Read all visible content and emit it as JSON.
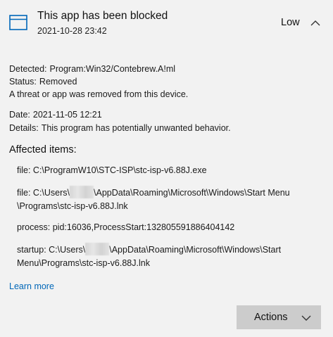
{
  "header": {
    "title": "This app has been blocked",
    "timestamp": "2021-10-28 23:42",
    "severity": "Low",
    "app_icon": "app-window-icon",
    "chevron_icon": "chevron-up-icon"
  },
  "details": {
    "detected_label": "Detected:",
    "detected_value": "Program:Win32/Contebrew.A!ml",
    "status_label": "Status:",
    "status_value": "Removed",
    "status_message": "A threat or app was removed from this device.",
    "date_label": "Date:",
    "date_value": "2021-11-05 12:21",
    "details_label": "Details:",
    "details_value": "This program has potentially unwanted behavior."
  },
  "affected": {
    "heading": "Affected items:",
    "items": [
      {
        "line1": "file: C:\\ProgramW10\\STC-ISP\\stc-isp-v6.88J.exe"
      },
      {
        "line1_pre": "file: C:\\Users\\",
        "line1_post": "\\AppData\\Roaming\\Microsoft\\Windows\\Start Menu",
        "line2": "\\Programs\\stc-isp-v6.88J.lnk"
      },
      {
        "line1": "process: pid:16036,ProcessStart:132805591886404142"
      },
      {
        "line1_pre": "startup: C:\\Users\\",
        "line1_post": "\\AppData\\Roaming\\Microsoft\\Windows\\Start",
        "line2": "Menu\\Programs\\stc-isp-v6.88J.lnk"
      }
    ]
  },
  "links": {
    "learn_more": "Learn more"
  },
  "actions": {
    "label": "Actions",
    "chevron_icon": "chevron-down-icon"
  },
  "colors": {
    "background": "#f2f2f2",
    "link": "#0067b8",
    "icon_blue": "#0067b8",
    "button": "#cccccc"
  }
}
